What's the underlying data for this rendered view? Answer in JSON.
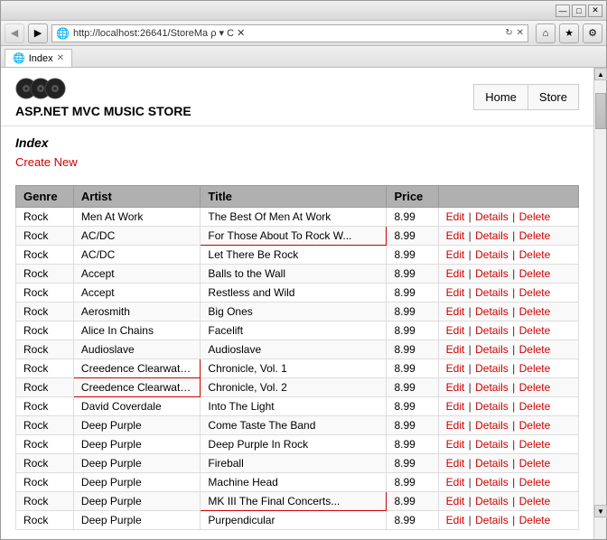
{
  "browser": {
    "title_bar_buttons": [
      "—",
      "□",
      "✕"
    ],
    "address": "http://localhost:26641/StoreMa ρ ▾ C ✕",
    "tab_title": "Index",
    "tab_icon": "🌐",
    "nav_back": "◀",
    "nav_forward": "▶",
    "scroll_up": "▲",
    "scroll_down": "▼",
    "home_icon": "⌂",
    "star_icon": "★",
    "settings_icon": "⚙"
  },
  "site": {
    "title": "ASP.NET MVC MUSIC STORE",
    "nav_items": [
      "Home",
      "Store"
    ]
  },
  "page": {
    "heading": "Index",
    "create_link": "Create New"
  },
  "table": {
    "headers": [
      "Genre",
      "Artist",
      "Title",
      "Price"
    ],
    "rows": [
      {
        "genre": "Rock",
        "artist": "Men At Work",
        "title": "The Best Of Men At Work",
        "price": "8.99",
        "truncated_title": false,
        "truncated_artist": false
      },
      {
        "genre": "Rock",
        "artist": "AC/DC",
        "title": "For Those About To Rock W...",
        "price": "8.99",
        "truncated_title": true,
        "truncated_artist": false
      },
      {
        "genre": "Rock",
        "artist": "AC/DC",
        "title": "Let There Be Rock",
        "price": "8.99",
        "truncated_title": false,
        "truncated_artist": false
      },
      {
        "genre": "Rock",
        "artist": "Accept",
        "title": "Balls to the Wall",
        "price": "8.99",
        "truncated_title": false,
        "truncated_artist": false
      },
      {
        "genre": "Rock",
        "artist": "Accept",
        "title": "Restless and Wild",
        "price": "8.99",
        "truncated_title": false,
        "truncated_artist": false
      },
      {
        "genre": "Rock",
        "artist": "Aerosmith",
        "title": "Big Ones",
        "price": "8.99",
        "truncated_title": false,
        "truncated_artist": false
      },
      {
        "genre": "Rock",
        "artist": "Alice In Chains",
        "title": "Facelift",
        "price": "8.99",
        "truncated_title": false,
        "truncated_artist": false
      },
      {
        "genre": "Rock",
        "artist": "Audioslave",
        "title": "Audioslave",
        "price": "8.99",
        "truncated_title": false,
        "truncated_artist": false
      },
      {
        "genre": "Rock",
        "artist": "Creedence Clearwater Revi...",
        "title": "Chronicle, Vol. 1",
        "price": "8.99",
        "truncated_title": false,
        "truncated_artist": true
      },
      {
        "genre": "Rock",
        "artist": "Creedence Clearwater Revi...",
        "title": "Chronicle, Vol. 2",
        "price": "8.99",
        "truncated_title": false,
        "truncated_artist": true
      },
      {
        "genre": "Rock",
        "artist": "David Coverdale",
        "title": "Into The Light",
        "price": "8.99",
        "truncated_title": false,
        "truncated_artist": false
      },
      {
        "genre": "Rock",
        "artist": "Deep Purple",
        "title": "Come Taste The Band",
        "price": "8.99",
        "truncated_title": false,
        "truncated_artist": false
      },
      {
        "genre": "Rock",
        "artist": "Deep Purple",
        "title": "Deep Purple In Rock",
        "price": "8.99",
        "truncated_title": false,
        "truncated_artist": false
      },
      {
        "genre": "Rock",
        "artist": "Deep Purple",
        "title": "Fireball",
        "price": "8.99",
        "truncated_title": false,
        "truncated_artist": false
      },
      {
        "genre": "Rock",
        "artist": "Deep Purple",
        "title": "Machine Head",
        "price": "8.99",
        "truncated_title": false,
        "truncated_artist": false
      },
      {
        "genre": "Rock",
        "artist": "Deep Purple",
        "title": "MK III The Final Concerts...",
        "price": "8.99",
        "truncated_title": true,
        "truncated_artist": false
      },
      {
        "genre": "Rock",
        "artist": "Deep Purple",
        "title": "Purpendicular",
        "price": "8.99",
        "truncated_title": false,
        "truncated_artist": false
      }
    ],
    "actions": [
      "Edit",
      "Details",
      "Delete"
    ]
  }
}
